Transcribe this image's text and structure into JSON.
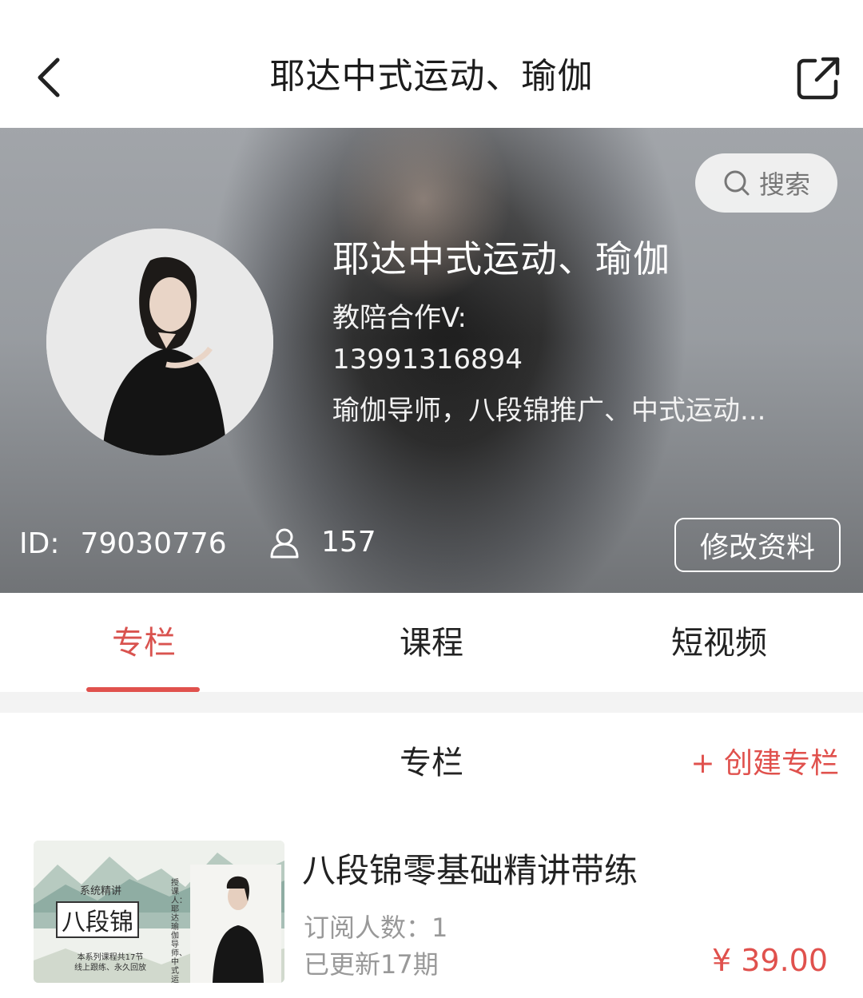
{
  "nav": {
    "title": "耶达中式运动、瑜伽"
  },
  "profile": {
    "search_label": "搜索",
    "name": "耶达中式运动、瑜伽",
    "bio_lines": [
      "教陪合作V:",
      "13991316894",
      "瑜伽导师，八段锦推广、中式运动..."
    ],
    "id_label": "ID:",
    "id_value": "79030776",
    "followers": "157",
    "edit_label": "修改资料"
  },
  "tabs": [
    {
      "label": "专栏",
      "active": true
    },
    {
      "label": "课程",
      "active": false
    },
    {
      "label": "短视频",
      "active": false
    }
  ],
  "section": {
    "title": "专栏",
    "create_label": "+ 创建专栏"
  },
  "column_item": {
    "title": "八段锦零基础精讲带练",
    "subscribers": "订阅人数：1",
    "updated": "已更新17期",
    "price": "¥ 39.00",
    "cover": {
      "tag": "系统精讲",
      "main_text": "八段锦",
      "note": "本系列课程共17节\n线上跟练、永久回放",
      "side_text": "授课人：耶达 瑜伽导师、中式运动推广"
    }
  },
  "colors": {
    "accent": "#e0514d",
    "muted": "#999999"
  }
}
